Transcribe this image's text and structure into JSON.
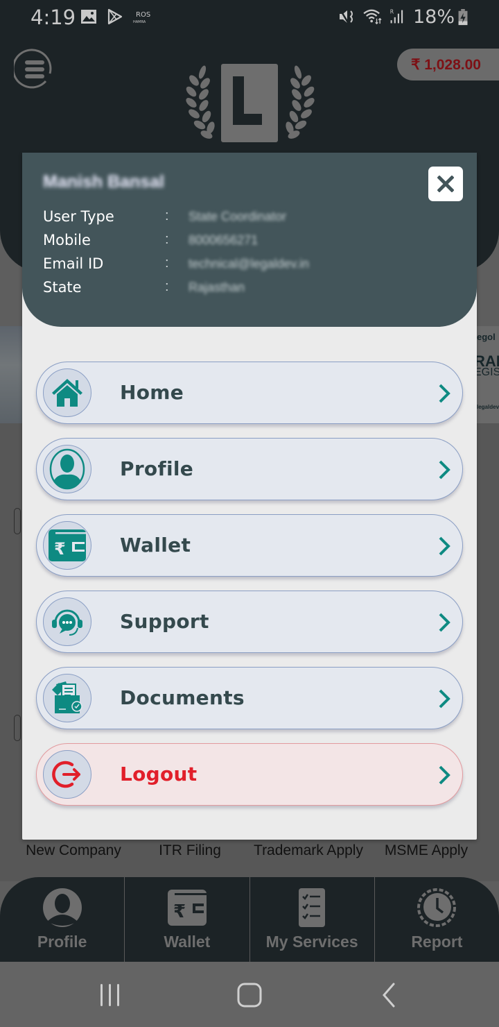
{
  "status_bar": {
    "time": "4:19",
    "notification_icons": [
      "gallery-icon",
      "play-store-icon",
      "ros-hamra-icon"
    ],
    "system_icons": [
      "mute-vibrate-icon",
      "wifi-icon",
      "signal-roaming-icon",
      "battery-charging-icon"
    ],
    "battery": "18%"
  },
  "header": {
    "menu_icon": "hamburger-menu-icon",
    "logo": "L",
    "wallet_balance": "₹ 1,028.00"
  },
  "profile_modal": {
    "user_name": "Manish Bansal",
    "fields": [
      {
        "label": "User Type",
        "separator": ":",
        "value": "State Coordinator"
      },
      {
        "label": "Mobile",
        "separator": ":",
        "value": "8000656271"
      },
      {
        "label": "Email ID",
        "separator": ":",
        "value": "technical@legaldev.in"
      },
      {
        "label": "State",
        "separator": ":",
        "value": "Rajasthan"
      }
    ],
    "close_icon": "close-icon",
    "menu": [
      {
        "label": "Home",
        "icon": "home-icon"
      },
      {
        "label": "Profile",
        "icon": "profile-icon"
      },
      {
        "label": "Wallet",
        "icon": "wallet-icon"
      },
      {
        "label": "Support",
        "icon": "support-icon"
      },
      {
        "label": "Documents",
        "icon": "documents-icon"
      },
      {
        "label": "Logout",
        "icon": "logout-icon"
      }
    ]
  },
  "background": {
    "banner_right_text": [
      "egol",
      "RAD",
      "EGIS",
      "legaldev"
    ],
    "services": [
      "New Company",
      "ITR Filing",
      "Trademark Apply",
      "MSME Apply"
    ]
  },
  "bottom_nav": [
    {
      "label": "Profile",
      "icon": "profile-icon"
    },
    {
      "label": "Wallet",
      "icon": "wallet-icon"
    },
    {
      "label": "My Services",
      "icon": "checklist-icon"
    },
    {
      "label": "Report",
      "icon": "clock-icon"
    }
  ],
  "system_nav": [
    "recents-icon",
    "home-icon",
    "back-icon"
  ],
  "colors": {
    "accent_teal": "#0e8a82",
    "logout_red": "#e11f2a",
    "card_dark": "#43555a",
    "balance_text": "#7d1015"
  }
}
